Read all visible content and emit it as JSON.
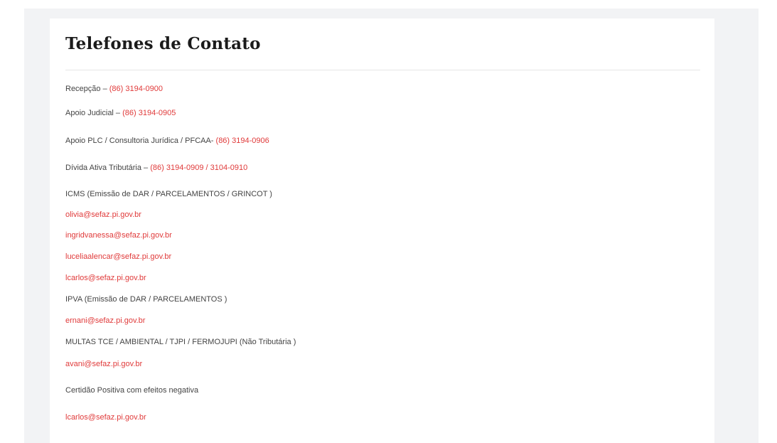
{
  "title": "Telefones de Contato",
  "colors": {
    "accent": "#e03a3a",
    "text": "#444444",
    "heading": "#1b1b1b"
  },
  "rows": [
    {
      "label": "Recepção – ",
      "value": "(86) 3194-0900"
    },
    {
      "label": "Apoio Judicial – ",
      "value": "(86) 3194-0905"
    },
    {
      "label": "Apoio PLC / Consultoria Jurídica / PFCAA- ",
      "value": "(86) 3194-0906"
    },
    {
      "label": "Dívida Ativa Tributária – ",
      "value": "(86) 3194-0909 / 3104-0910"
    }
  ],
  "icms": {
    "heading": "ICMS (Emissão de DAR / PARCELAMENTOS / GRINCOT )",
    "emails": [
      "olivia@sefaz.pi.gov.br",
      "ingridvanessa@sefaz.pi.gov.br",
      "luceliaalencar@sefaz.pi.gov.br",
      "lcarlos@sefaz.pi.gov.br"
    ]
  },
  "ipva": {
    "heading": "IPVA (Emissão de DAR / PARCELAMENTOS )",
    "email": "ernani@sefaz.pi.gov.br"
  },
  "multas": {
    "heading": "MULTAS TCE / AMBIENTAL / TJPI / FERMOJUPI (Não Tributária )",
    "email": "avani@sefaz.pi.gov.br"
  },
  "certidao": {
    "heading": "Certidão Positiva com efeitos negativa",
    "email": "lcarlos@sefaz.pi.gov.br"
  }
}
